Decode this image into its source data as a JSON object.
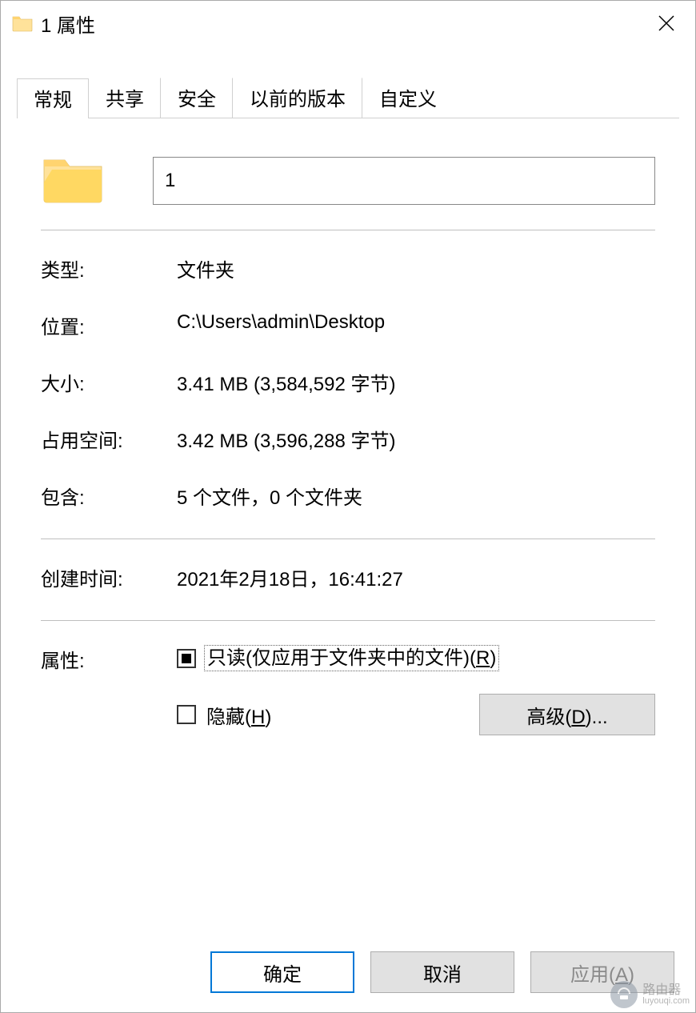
{
  "titlebar": {
    "title": "1 属性"
  },
  "tabs": {
    "general": "常规",
    "share": "共享",
    "security": "安全",
    "previous": "以前的版本",
    "custom": "自定义"
  },
  "name_field": {
    "value": "1"
  },
  "props": {
    "type_label": "类型:",
    "type_value": "文件夹",
    "location_label": "位置:",
    "location_value": "C:\\Users\\admin\\Desktop",
    "size_label": "大小:",
    "size_value": "3.41 MB (3,584,592 字节)",
    "disk_label": "占用空间:",
    "disk_value": "3.42 MB (3,596,288 字节)",
    "contains_label": "包含:",
    "contains_value": "5 个文件，0 个文件夹",
    "created_label": "创建时间:",
    "created_value": "2021年2月18日，16:41:27"
  },
  "attributes": {
    "label": "属性:",
    "readonly_prefix": "只读(仅应用于文件夹中的文件)(",
    "readonly_key": "R",
    "readonly_suffix": ")",
    "hidden_prefix": "隐藏(",
    "hidden_key": "H",
    "hidden_suffix": ")",
    "advanced_prefix": "高级(",
    "advanced_key": "D",
    "advanced_suffix": ")..."
  },
  "buttons": {
    "ok": "确定",
    "cancel": "取消",
    "apply_prefix": "应用(",
    "apply_key": "A",
    "apply_suffix": ")"
  },
  "watermark": {
    "main": "路由器",
    "sub": "luyouqi.com"
  }
}
